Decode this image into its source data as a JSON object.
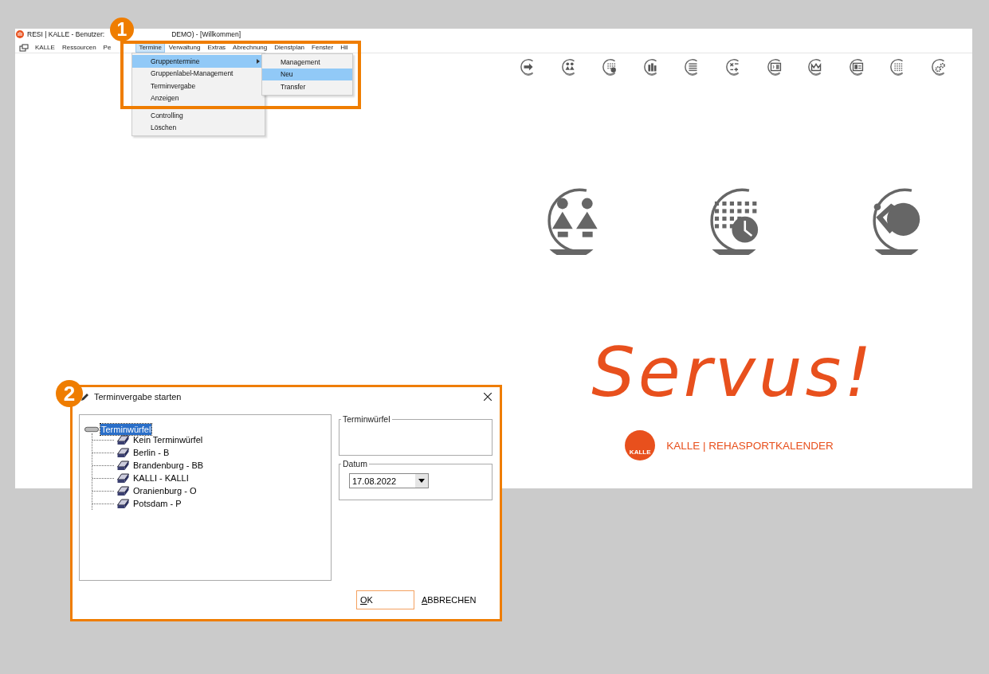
{
  "window": {
    "title": "RESI | KALLE - Benutzer:",
    "title_rest": "DEMO) - [Willkommen]"
  },
  "menu_bar": [
    {
      "label": "KALLE",
      "selected": false
    },
    {
      "label": "Ressourcen",
      "selected": false
    },
    {
      "label": "Pe",
      "selected": false
    },
    {
      "label": "Termine",
      "selected": true
    },
    {
      "label": "Verwaltung",
      "selected": false
    },
    {
      "label": "Extras",
      "selected": false
    },
    {
      "label": "Abrechnung",
      "selected": false
    },
    {
      "label": "Dienstplan",
      "selected": false
    },
    {
      "label": "Fenster",
      "selected": false
    },
    {
      "label": "Hil",
      "selected": false
    }
  ],
  "dropdown": [
    {
      "label": "Gruppentermine",
      "selected": true,
      "submenu": true
    },
    {
      "label": "Gruppenlabel-Management",
      "selected": false,
      "submenu": false
    },
    {
      "label": "Terminvergabe",
      "selected": false,
      "submenu": false
    },
    {
      "label": "Anzeigen",
      "selected": false,
      "submenu": false
    },
    {
      "label": "Controlling",
      "selected": false,
      "submenu": false
    },
    {
      "label": "Löschen",
      "selected": false,
      "submenu": false
    }
  ],
  "submenu": [
    {
      "label": "Management",
      "selected": false
    },
    {
      "label": "Neu",
      "selected": true
    },
    {
      "label": "Transfer",
      "selected": false
    }
  ],
  "welcome": {
    "greeting": "Servus!",
    "brand": "KALLE | REHASPORTKALENDER",
    "logo_text": "KALLE"
  },
  "dialog": {
    "title": "Terminvergabe starten",
    "tree": {
      "label": "Terminwürfel",
      "selected": true,
      "children": [
        {
          "label": "Kein Terminwürfel",
          "selected": false
        },
        {
          "label": "Berlin - B",
          "selected": false
        },
        {
          "label": "Brandenburg - BB",
          "selected": false
        },
        {
          "label": "KALLI - KALLI",
          "selected": false
        },
        {
          "label": "Oranienburg - O",
          "selected": false
        },
        {
          "label": "Potsdam - P",
          "selected": false
        }
      ]
    },
    "group_1": {
      "label": "Terminwürfel"
    },
    "group_2": {
      "label": "Datum",
      "date": "17.08.2022"
    },
    "buttons": [
      {
        "label": "OK",
        "focused": true
      },
      {
        "label": "ABBRECHEN",
        "focused": false
      }
    ]
  },
  "annotations": [
    {
      "label": "1"
    },
    {
      "label": "2"
    }
  ]
}
